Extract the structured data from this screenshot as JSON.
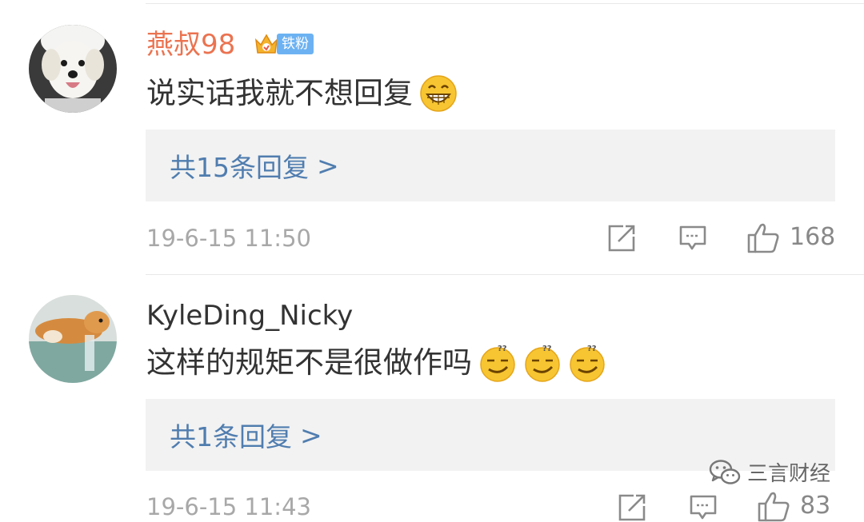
{
  "comments": [
    {
      "username": "燕叔98",
      "fan_badge": "铁粉",
      "text": "说实话我就不想回复",
      "emoji": "grin-emoji",
      "reply_summary": "共15条回复",
      "reply_arrow": ">",
      "timestamp": "19-6-15 11:50",
      "likes": "168"
    },
    {
      "username": "KyleDing_Nicky",
      "text": "这样的规矩不是很做作吗",
      "emoji": "smirk-emoji",
      "reply_summary": "共1条回复",
      "reply_arrow": ">",
      "timestamp": "19-6-15 11:43",
      "likes": "83"
    }
  ],
  "watermark": {
    "label": "三言财经",
    "icon": "wechat-icon"
  },
  "colors": {
    "username_vip": "#eb7350",
    "reply_link": "#507daf",
    "reply_bg": "#f2f2f2",
    "fan_badge_bg": "#6cb2f2",
    "timestamp": "#a8a8a8"
  }
}
